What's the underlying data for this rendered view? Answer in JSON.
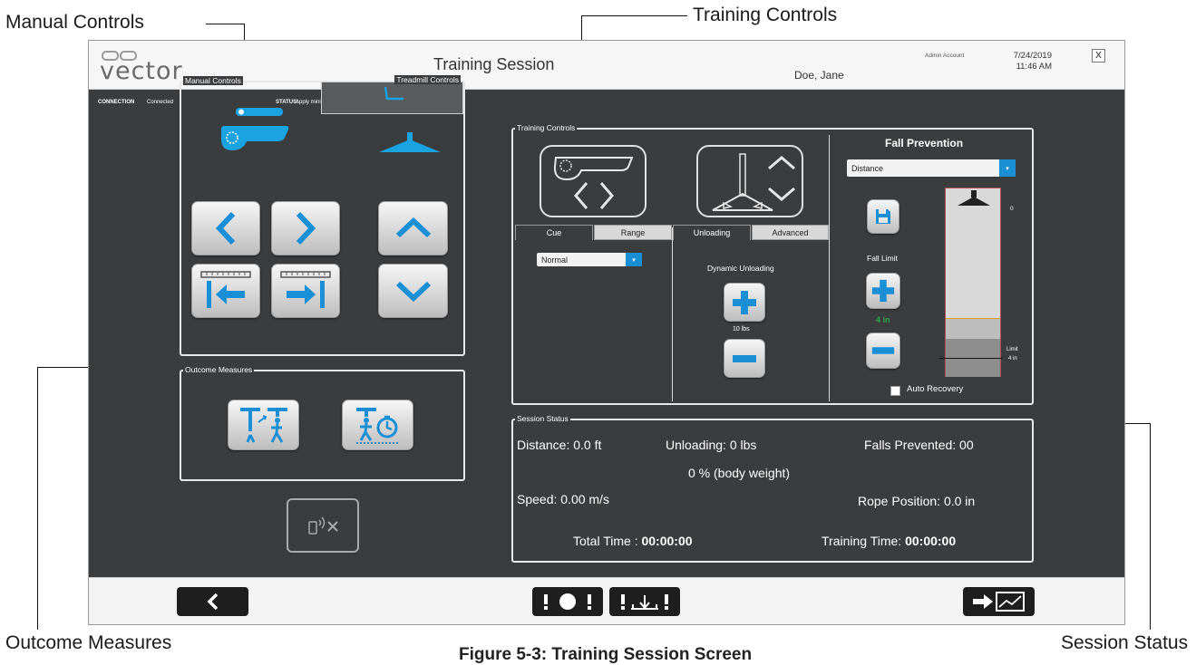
{
  "callouts": {
    "manual_controls": "Manual Controls",
    "training_controls": "Training Controls",
    "outcome_measures": "Outcome Measures",
    "session_status": "Session Status"
  },
  "caption": "Figure 5-3: Training Session Screen",
  "header": {
    "logo": "vector",
    "title": "Training Session",
    "patient": "Doe, Jane",
    "account": "Admin Account",
    "date": "7/24/2019",
    "time": "11:46 AM",
    "close": "X"
  },
  "status_line": {
    "connection_label": "CONNECTION",
    "connection_value": "Connected",
    "status_label": "STATUS:",
    "status_value": "Apply minimum unloading to begin training."
  },
  "manual_controls": {
    "legend": "Manual Controls",
    "treadmill_tab": "Treadmill Controls"
  },
  "outcome_measures": {
    "legend": "Outcome Measures"
  },
  "training_controls": {
    "legend": "Training Controls",
    "tabs_left": [
      "Cue",
      "Range"
    ],
    "tabs_right": [
      "Unloading",
      "Advanced"
    ],
    "cue_select": "Normal",
    "dynamic_unloading": "Dynamic Unloading",
    "unloading_value": "10 lbs",
    "fall_prevention": {
      "title": "Fall Prevention",
      "mode": "Distance",
      "fall_limit_label": "Fall Limit",
      "fall_limit_value": "4 in",
      "scale_top": "0",
      "limit_label": "Limit",
      "limit_value": "4 in",
      "auto_recovery": "Auto Recovery"
    }
  },
  "session_status": {
    "legend": "Session Status",
    "distance": "Distance: 0.0 ft",
    "unloading": "Unloading: 0  lbs",
    "body_weight": "0 % (body weight)",
    "falls_prevented": "Falls Prevented: 00",
    "speed": "Speed: 0.00 m/s",
    "rope_position": "Rope Position: 0.0 in",
    "total_time_label": "Total Time : ",
    "total_time": "00:00:00",
    "training_time_label": "Training Time: ",
    "training_time": "00:00:00"
  },
  "colors": {
    "accent_blue": "#1a8fd6",
    "icon_blue": "#19a3e0",
    "background": "#3b3c3e",
    "fall_limit_green": "#2ea84a"
  }
}
